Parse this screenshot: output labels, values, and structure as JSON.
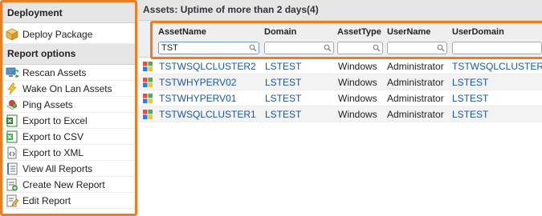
{
  "sidebar": {
    "deployment_header": "Deployment",
    "deploy_package": "Deploy Package",
    "report_options_header": "Report options",
    "items": [
      {
        "label": "Rescan Assets",
        "icon": "rescan-icon"
      },
      {
        "label": "Wake On Lan Assets",
        "icon": "lightning-icon"
      },
      {
        "label": "Ping Assets",
        "icon": "ping-icon"
      },
      {
        "label": "Export to Excel",
        "icon": "excel-icon"
      },
      {
        "label": "Export to CSV",
        "icon": "csv-icon"
      },
      {
        "label": "Export to XML",
        "icon": "xml-icon"
      },
      {
        "label": "View All Reports",
        "icon": "report-list-icon"
      },
      {
        "label": "Create New Report",
        "icon": "new-report-icon"
      },
      {
        "label": "Edit Report",
        "icon": "edit-report-icon"
      }
    ]
  },
  "main": {
    "title": "Assets: Uptime of more than 2 days(4)",
    "columns": [
      {
        "label": "AssetName",
        "filter": "TST"
      },
      {
        "label": "Domain",
        "filter": ""
      },
      {
        "label": "AssetType",
        "filter": ""
      },
      {
        "label": "UserName",
        "filter": ""
      },
      {
        "label": "UserDomain",
        "filter": ""
      }
    ],
    "rows": [
      [
        "TSTWSQLCLUSTER2",
        "LSTEST",
        "Windows",
        "Administrator",
        "TSTWSQLCLUSTER"
      ],
      [
        "TSTWHYPERV02",
        "LSTEST",
        "Windows",
        "Administrator",
        "LSTEST"
      ],
      [
        "TSTWHYPERV01",
        "LSTEST",
        "Windows",
        "Administrator",
        "LSTEST"
      ],
      [
        "TSTWSQLCLUSTER1",
        "LSTEST",
        "Windows",
        "Administrator",
        "LSTEST"
      ]
    ]
  },
  "colors": {
    "highlight": "#ec7d22",
    "link": "#1a57a8",
    "header_bg": "#e6e6e6"
  }
}
